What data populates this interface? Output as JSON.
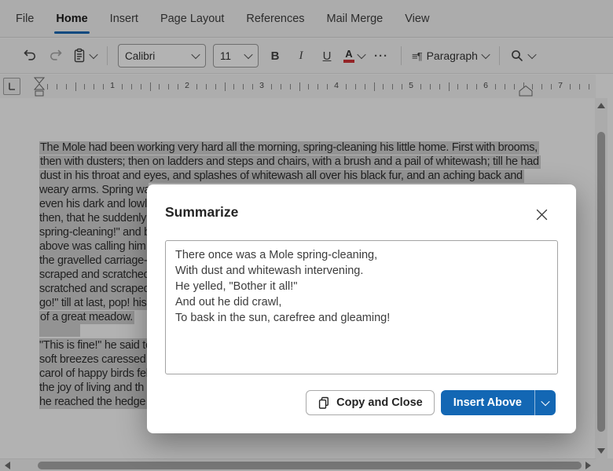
{
  "colors": {
    "accent": "#1367b4",
    "selection": "#d0d0d0",
    "red": "#d13438"
  },
  "menu": {
    "items": [
      {
        "label": "File",
        "active": false
      },
      {
        "label": "Home",
        "active": true
      },
      {
        "label": "Insert",
        "active": false
      },
      {
        "label": "Page Layout",
        "active": false
      },
      {
        "label": "References",
        "active": false
      },
      {
        "label": "Mail Merge",
        "active": false
      },
      {
        "label": "View",
        "active": false
      }
    ]
  },
  "toolbar": {
    "font_name": "Calibri",
    "font_size": "11",
    "bold_label": "B",
    "italic_label": "I",
    "underline_label": "U",
    "font_color_letter": "A",
    "more_options": "···",
    "paragraph_icon": "≡¶",
    "paragraph_label": "Paragraph"
  },
  "ruler": {
    "numbers": [
      "1",
      "2",
      "3",
      "4",
      "5",
      "6",
      "7"
    ]
  },
  "document": {
    "lines": [
      {
        "mode": "full",
        "text": "The Mole had been working very hard all the morning, spring-cleaning his little home. First with brooms,"
      },
      {
        "mode": "full",
        "text": "then with dusters; then on ladders and steps and chairs, with a brush and a pail of whitewash; till he had"
      },
      {
        "mode": "full",
        "text": "dust in his throat and eyes, and splashes of whitewash all over his black fur, and an aching back and"
      },
      {
        "mode": "cut",
        "text": "weary arms. Spring wa"
      },
      {
        "mode": "cut",
        "text": "even his dark and lowly"
      },
      {
        "mode": "cut",
        "text": "then, that he suddenly"
      },
      {
        "mode": "cut",
        "text": "spring-cleaning!\" and b"
      },
      {
        "mode": "cut",
        "text": "above was calling him i"
      },
      {
        "mode": "cut",
        "text": "the gravelled carriage-"
      },
      {
        "mode": "cut",
        "text": "scraped and scratched"
      },
      {
        "mode": "cut",
        "text": "scratched and scraped,"
      },
      {
        "mode": "cut",
        "text": "go!\" till at last, pop! his"
      },
      {
        "mode": "full",
        "text": "of a great meadow."
      },
      {
        "mode": "blank",
        "text": ""
      },
      {
        "mode": "cut",
        "text": "\"This is fine!\" he said to"
      },
      {
        "mode": "cut",
        "text": "soft breezes caressed h"
      },
      {
        "mode": "cut",
        "text": "carol of happy birds fel"
      },
      {
        "mode": "cut",
        "text": "the joy of living and th"
      },
      {
        "mode": "cut",
        "text": "he reached the hedge o"
      }
    ]
  },
  "dialog": {
    "title": "Summarize",
    "summary_text": "There once was a Mole spring-cleaning,\nWith dust and whitewash intervening.\nHe yelled, \"Bother it all!\"\nAnd out he did crawl,\nTo bask in the sun, carefree and gleaming!",
    "copy_and_close_label": "Copy and Close",
    "insert_above_label": "Insert Above"
  }
}
